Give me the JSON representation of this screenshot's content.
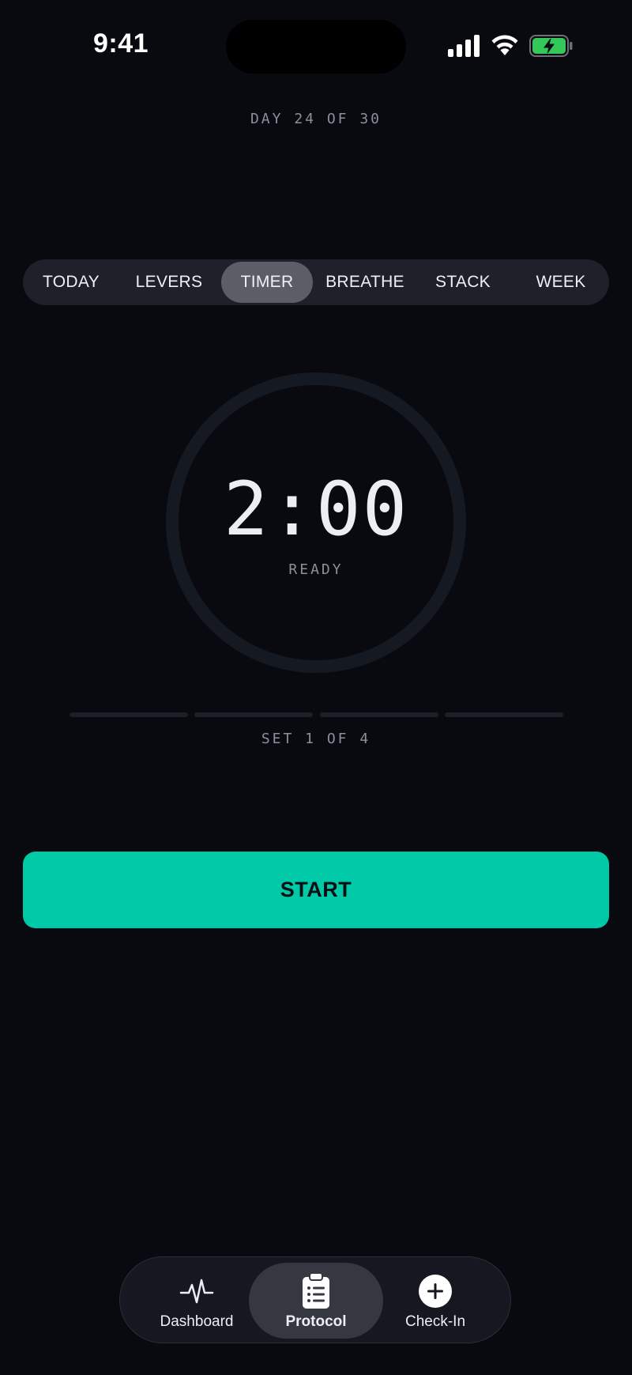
{
  "status_bar": {
    "time": "9:41",
    "icons": [
      "signal-icon",
      "wifi-icon",
      "battery-charging-icon"
    ],
    "battery_color": "#34c759"
  },
  "header": {
    "day_label": "DAY 24 OF 30"
  },
  "tabs": [
    {
      "label": "TODAY",
      "active": false
    },
    {
      "label": "LEVERS",
      "active": false
    },
    {
      "label": "TIMER",
      "active": true
    },
    {
      "label": "BREATHE",
      "active": false
    },
    {
      "label": "STACK",
      "active": false
    },
    {
      "label": "WEEK",
      "active": false
    }
  ],
  "timer": {
    "value": "2:00",
    "status": "READY",
    "progress": 0
  },
  "sets": {
    "label": "SET 1 OF 4",
    "total": 4,
    "completed": 0
  },
  "start_button": {
    "label": "START"
  },
  "bottom_nav": {
    "items": [
      {
        "label": "Dashboard",
        "icon": "pulse-icon",
        "active": false
      },
      {
        "label": "Protocol",
        "icon": "clipboard-list-icon",
        "active": true
      },
      {
        "label": "Check-In",
        "icon": "plus-circle-icon",
        "active": false
      }
    ]
  },
  "colors": {
    "background": "#080a0f",
    "accent": "#00c9a7",
    "muted_text": "#8a909c",
    "tab_bar": "#1e2129",
    "tab_active": "#5b5e66"
  }
}
